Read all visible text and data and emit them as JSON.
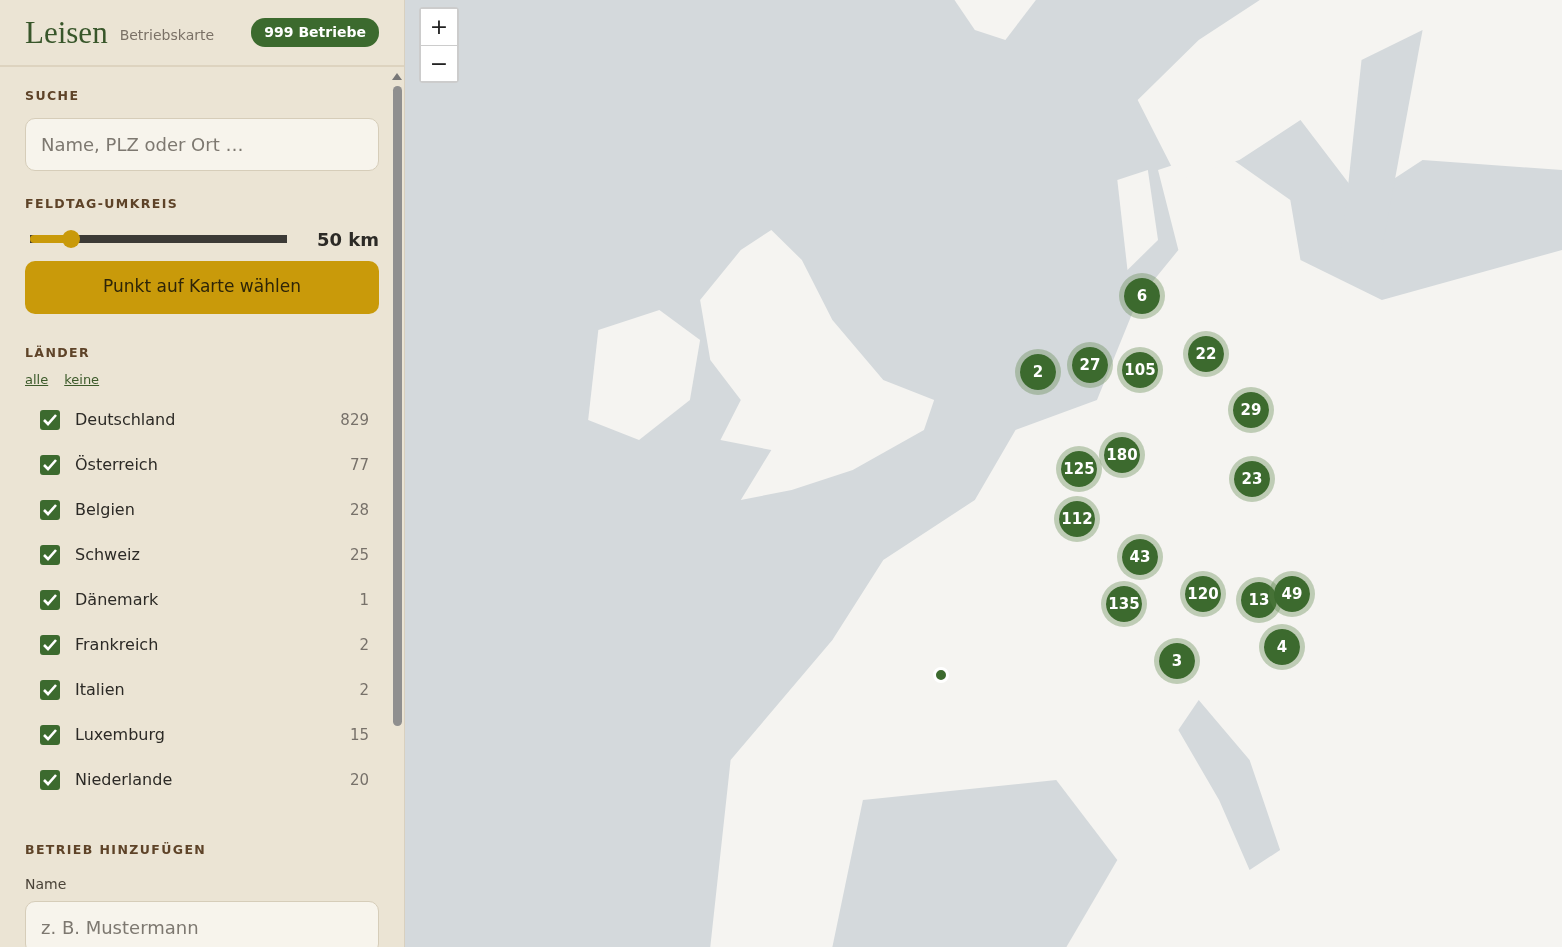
{
  "header": {
    "logo": "Leisen",
    "subtitle": "Betriebskarte",
    "badge": "999 Betriebe"
  },
  "search": {
    "heading": "SUCHE",
    "placeholder": "Name, PLZ oder Ort …"
  },
  "radius": {
    "heading": "FELDTAG-UMKREIS",
    "level": 0.16,
    "reading": "50 km",
    "button": "Punkt auf Karte wählen"
  },
  "countries": {
    "heading": "LÄNDER",
    "links": [
      "alle",
      "keine"
    ],
    "items": [
      {
        "name": "Deutschland",
        "count": "829",
        "checked": true
      },
      {
        "name": "Österreich",
        "count": "77",
        "checked": true
      },
      {
        "name": "Belgien",
        "count": "28",
        "checked": true
      },
      {
        "name": "Schweiz",
        "count": "25",
        "checked": true
      },
      {
        "name": "Dänemark",
        "count": "1",
        "checked": true
      },
      {
        "name": "Frankreich",
        "count": "2",
        "checked": true
      },
      {
        "name": "Italien",
        "count": "2",
        "checked": true
      },
      {
        "name": "Luxemburg",
        "count": "15",
        "checked": true
      },
      {
        "name": "Niederlande",
        "count": "20",
        "checked": true
      }
    ]
  },
  "add": {
    "heading": "BETRIEB HINZUFÜGEN",
    "label": "Name",
    "placeholder": "z. B. Mustermann"
  },
  "map": {
    "zoom": [
      "+",
      "−"
    ],
    "markers": [
      {
        "kind": "cluster",
        "count": "6"
      },
      {
        "kind": "cluster",
        "count": "2"
      },
      {
        "kind": "cluster",
        "count": "27"
      },
      {
        "kind": "cluster",
        "count": "105"
      },
      {
        "kind": "cluster",
        "count": "22"
      },
      {
        "kind": "cluster",
        "count": "29"
      },
      {
        "kind": "cluster",
        "count": "180"
      },
      {
        "kind": "cluster",
        "count": "125"
      },
      {
        "kind": "cluster",
        "count": "23"
      },
      {
        "kind": "cluster",
        "count": "112"
      },
      {
        "kind": "cluster",
        "count": "43"
      },
      {
        "kind": "cluster",
        "count": "135"
      },
      {
        "kind": "cluster",
        "count": "120"
      },
      {
        "kind": "cluster",
        "count": "13"
      },
      {
        "kind": "cluster",
        "count": "49"
      },
      {
        "kind": "cluster",
        "count": "3"
      },
      {
        "kind": "cluster",
        "count": "4"
      },
      {
        "kind": "point"
      }
    ]
  }
}
